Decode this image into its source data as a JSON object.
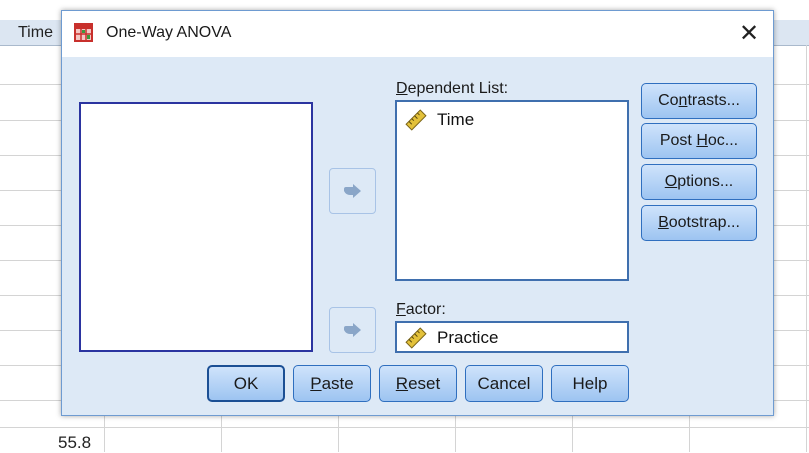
{
  "spreadsheet": {
    "column_header": "Time",
    "visible_value": "55.8"
  },
  "dialog": {
    "title": "One-Way ANOVA",
    "close_glyph": "✕",
    "dependent_list": {
      "label_mnemonic": "D",
      "label_rest": "ependent List:",
      "items": [
        "Time"
      ]
    },
    "factor": {
      "label_mnemonic": "F",
      "label_rest": "actor:",
      "value": "Practice"
    },
    "side_buttons": {
      "contrasts": {
        "pre": "Co",
        "mn": "n",
        "post": "trasts..."
      },
      "post_hoc": {
        "pre": "Post ",
        "mn": "H",
        "post": "oc..."
      },
      "options": {
        "pre": "",
        "mn": "O",
        "post": "ptions..."
      },
      "bootstrap": {
        "pre": "",
        "mn": "B",
        "post": "ootstrap..."
      }
    },
    "bottom_buttons": {
      "ok": {
        "pre": "OK",
        "mn": "",
        "post": ""
      },
      "paste": {
        "pre": "",
        "mn": "P",
        "post": "aste"
      },
      "reset": {
        "pre": "",
        "mn": "R",
        "post": "eset"
      },
      "cancel": {
        "pre": "Cancel",
        "mn": "",
        "post": ""
      },
      "help": {
        "pre": "Help",
        "mn": "",
        "post": ""
      }
    },
    "icons": {
      "app": "spss-data-grid-icon",
      "variable": "scale-ruler-icon",
      "move": "move-right-arrow-icon"
    },
    "colors": {
      "dialog_bg": "#dde9f6",
      "button_border": "#2f6fbf",
      "list_border_active": "#2b34a0"
    }
  }
}
